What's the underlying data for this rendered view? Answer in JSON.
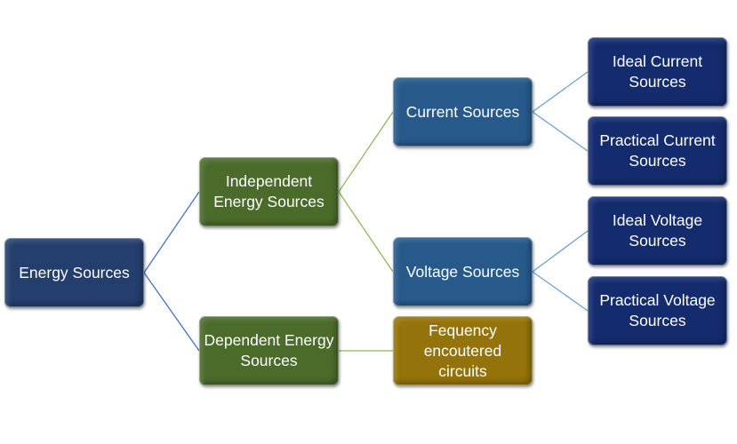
{
  "colors": {
    "root": "#243f6e",
    "level1": "#4b6b2b",
    "level2": "#275a8a",
    "frequency": "#94730a",
    "level3": "#142c6e",
    "connector_root": "#4472c4",
    "connector_green": "#8db85a",
    "connector_blue": "#6fa0d0"
  },
  "nodes": {
    "energy": "Energy Sources",
    "independent": "Independent Energy Sources",
    "dependent": "Dependent Energy Sources",
    "current": "Current Sources",
    "voltage": "Voltage Sources",
    "frequency": "Fequency encoutered circuits",
    "ideal_current": "Ideal Current Sources",
    "practical_current": "Practical Current Sources",
    "ideal_voltage": "Ideal Voltage Sources",
    "practical_voltage": "Practical  Voltage Sources"
  },
  "edges": [
    [
      "energy",
      "independent"
    ],
    [
      "energy",
      "dependent"
    ],
    [
      "independent",
      "current"
    ],
    [
      "independent",
      "voltage"
    ],
    [
      "dependent",
      "frequency"
    ],
    [
      "current",
      "ideal_current"
    ],
    [
      "current",
      "practical_current"
    ],
    [
      "voltage",
      "ideal_voltage"
    ],
    [
      "voltage",
      "practical_voltage"
    ]
  ]
}
